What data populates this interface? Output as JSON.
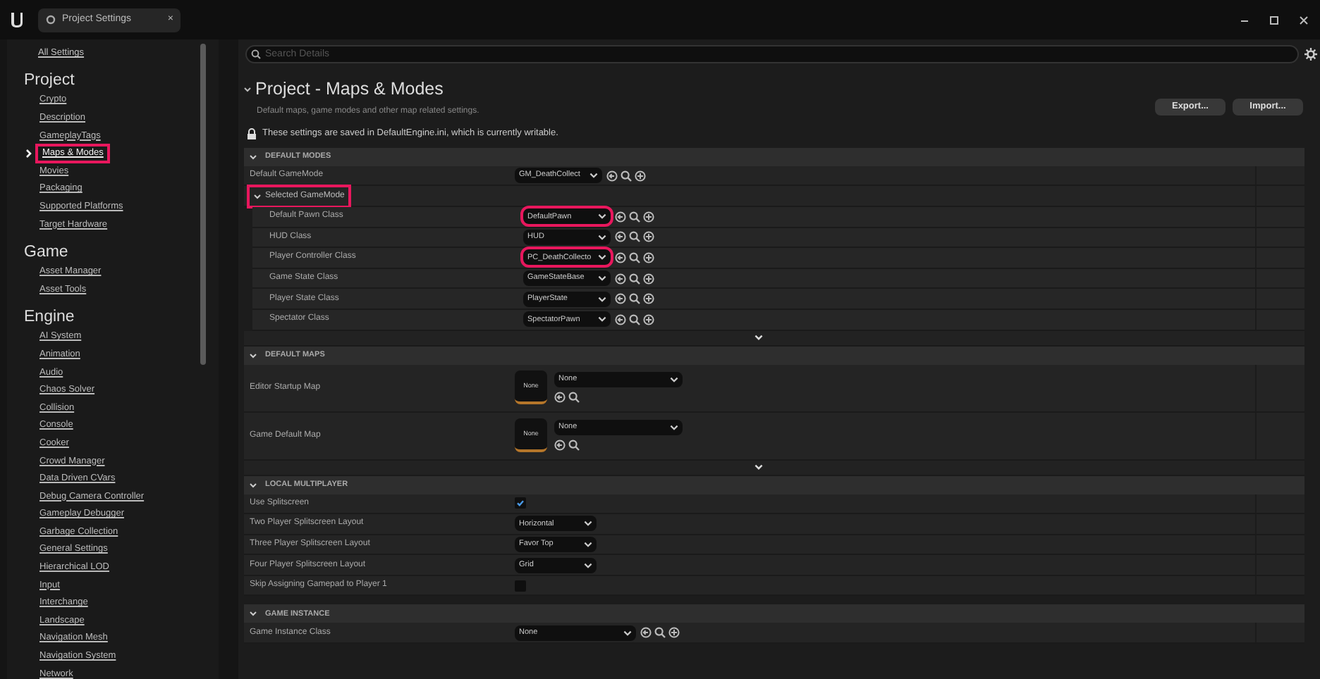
{
  "tab": {
    "title": "Project Settings",
    "close": "×"
  },
  "sidebar": {
    "all_settings": "All Settings",
    "sections": [
      {
        "title": "Project",
        "items": [
          {
            "label": "Crypto",
            "selected": false,
            "highlighted": false
          },
          {
            "label": "Description",
            "selected": false,
            "highlighted": false
          },
          {
            "label": "GameplayTags",
            "selected": false,
            "highlighted": false
          },
          {
            "label": "Maps & Modes",
            "selected": true,
            "highlighted": true
          },
          {
            "label": "Movies",
            "selected": false,
            "highlighted": false
          },
          {
            "label": "Packaging",
            "selected": false,
            "highlighted": false
          },
          {
            "label": "Supported Platforms",
            "selected": false,
            "highlighted": false
          },
          {
            "label": "Target Hardware",
            "selected": false,
            "highlighted": false
          }
        ]
      },
      {
        "title": "Game",
        "items": [
          {
            "label": "Asset Manager",
            "selected": false,
            "highlighted": false
          },
          {
            "label": "Asset Tools",
            "selected": false,
            "highlighted": false
          }
        ]
      },
      {
        "title": "Engine",
        "items": [
          {
            "label": "AI System",
            "selected": false,
            "highlighted": false
          },
          {
            "label": "Animation",
            "selected": false,
            "highlighted": false
          },
          {
            "label": "Audio",
            "selected": false,
            "highlighted": false
          },
          {
            "label": "Chaos Solver",
            "selected": false,
            "highlighted": false
          },
          {
            "label": "Collision",
            "selected": false,
            "highlighted": false
          },
          {
            "label": "Console",
            "selected": false,
            "highlighted": false
          },
          {
            "label": "Cooker",
            "selected": false,
            "highlighted": false
          },
          {
            "label": "Crowd Manager",
            "selected": false,
            "highlighted": false
          },
          {
            "label": "Data Driven CVars",
            "selected": false,
            "highlighted": false
          },
          {
            "label": "Debug Camera Controller",
            "selected": false,
            "highlighted": false
          },
          {
            "label": "Gameplay Debugger",
            "selected": false,
            "highlighted": false
          },
          {
            "label": "Garbage Collection",
            "selected": false,
            "highlighted": false
          },
          {
            "label": "General Settings",
            "selected": false,
            "highlighted": false
          },
          {
            "label": "Hierarchical LOD",
            "selected": false,
            "highlighted": false
          },
          {
            "label": "Input",
            "selected": false,
            "highlighted": false
          },
          {
            "label": "Interchange",
            "selected": false,
            "highlighted": false
          },
          {
            "label": "Landscape",
            "selected": false,
            "highlighted": false
          },
          {
            "label": "Navigation Mesh",
            "selected": false,
            "highlighted": false
          },
          {
            "label": "Navigation System",
            "selected": false,
            "highlighted": false
          },
          {
            "label": "Network",
            "selected": false,
            "highlighted": false
          }
        ]
      }
    ]
  },
  "search": {
    "placeholder": "Search Details"
  },
  "header": {
    "title": "Project - Maps & Modes",
    "description": "Default maps, game modes and other map related settings.",
    "notice": "These settings are saved in DefaultEngine.ini, which is currently writable.",
    "buttons": [
      "Export...",
      "Import..."
    ]
  },
  "categories": [
    {
      "title": "DEFAULT MODES",
      "expanded": true,
      "advanced": true,
      "rows": [
        {
          "kind": "class",
          "label": "Default GameMode",
          "value": "GM_DeathCollect",
          "highlighted": false
        },
        {
          "kind": "group",
          "label": "Selected GameMode",
          "expanded": true,
          "highlighted": true,
          "children": [
            {
              "kind": "class",
              "label": "Default Pawn Class",
              "value": "DefaultPawn",
              "highlighted": true
            },
            {
              "kind": "class",
              "label": "HUD Class",
              "value": "HUD",
              "highlighted": false
            },
            {
              "kind": "class",
              "label": "Player Controller Class",
              "value": "PC_DeathCollecto",
              "highlighted": true
            },
            {
              "kind": "class",
              "label": "Game State Class",
              "value": "GameStateBase",
              "highlighted": false
            },
            {
              "kind": "class",
              "label": "Player State Class",
              "value": "PlayerState",
              "highlighted": false
            },
            {
              "kind": "class",
              "label": "Spectator Class",
              "value": "SpectatorPawn",
              "highlighted": false
            }
          ]
        }
      ]
    },
    {
      "title": "DEFAULT MAPS",
      "expanded": true,
      "advanced": true,
      "rows": [
        {
          "kind": "map",
          "label": "Editor Startup Map",
          "thumbnail": "None",
          "value": "None"
        },
        {
          "kind": "map",
          "label": "Game Default Map",
          "thumbnail": "None",
          "value": "None"
        }
      ]
    },
    {
      "title": "LOCAL MULTIPLAYER",
      "expanded": true,
      "advanced": false,
      "rows": [
        {
          "kind": "checkbox",
          "label": "Use Splitscreen",
          "checked": true
        },
        {
          "kind": "enum",
          "label": "Two Player Splitscreen Layout",
          "value": "Horizontal"
        },
        {
          "kind": "enum",
          "label": "Three Player Splitscreen Layout",
          "value": "Favor Top"
        },
        {
          "kind": "enum",
          "label": "Four Player Splitscreen Layout",
          "value": "Grid"
        },
        {
          "kind": "checkbox",
          "label": "Skip Assigning Gamepad to Player 1",
          "checked": false
        }
      ]
    },
    {
      "title": "GAME INSTANCE",
      "expanded": true,
      "advanced": false,
      "rows": [
        {
          "kind": "wideclass",
          "label": "Game Instance Class",
          "value": "None"
        }
      ]
    }
  ]
}
